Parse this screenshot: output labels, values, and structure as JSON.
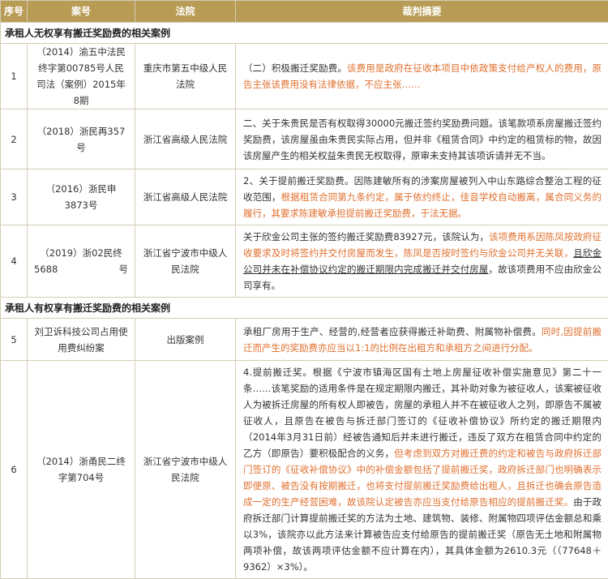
{
  "header": {
    "no": "序号",
    "case_no": "案号",
    "court": "法院",
    "summary": "裁判摘要"
  },
  "sections": [
    {
      "title": "承租人无权享有搬迁奖励费的相关案例",
      "rows": [
        {
          "no": "1",
          "case_no": "（2014）渝五中法民终字第00785号人民司法（案例）2015年8期",
          "court": "重庆市第五中级人民法院",
          "summary": [
            {
              "text": "（二）积极搬迁奖励费。",
              "style": ""
            },
            {
              "text": "该费用是政府在征收本项目中依政策支付给产权人的费用，原告主张该费用没有法律依据，不应主张……",
              "style": "orange"
            }
          ]
        },
        {
          "no": "2",
          "case_no": "（2018）浙民再357号",
          "court": "浙江省高级人民法院",
          "summary": [
            {
              "text": "二、关于朱贵民是否有权取得30000元搬迁签约奖励费问题。该笔款项系房屋搬迁签约奖励费，该房屋虽由朱贵民实际占用，但并非《租赁合同》中约定的租赁标的物，故因该房屋产生的相关权益朱贵民无权取得，原审未支持其该项诉请并无不当。",
              "style": ""
            }
          ]
        },
        {
          "no": "3",
          "case_no": "（2016）浙民申3873号",
          "court": "浙江省高级人民法院",
          "summary": [
            {
              "text": "2、关于提前搬迁奖励费。因陈建敏所有的涉案房屋被列入中山东路综合整治工程的征收范围，",
              "style": ""
            },
            {
              "text": "根据租赁合同第九条约定，属于依约终止，佳音学校自动搬离，属合同义务的履行，其要求陈建敏承担提前搬迁奖励费，于法无据。",
              "style": "orange"
            }
          ]
        },
        {
          "no": "4",
          "case_no": "（2019）浙02民终5688号",
          "court": "浙江省宁波市中级人民法院",
          "summary": [
            {
              "text": "关于欣金公司主张的签约搬迁奖励费83927元，该院认为，",
              "style": ""
            },
            {
              "text": "该项费用系因陈凤按政府征收要求及时将签约并交付房屋而发生，陈凤是否按时签约与欣金公司并无关联，",
              "style": "orange"
            },
            {
              "text": "且欣金公司并未在补偿协议约定的搬迁期限内完成搬迁并交付房屋",
              "style": "underline"
            },
            {
              "text": "，故该项费用不应由欣金公司享有。",
              "style": ""
            }
          ]
        }
      ]
    },
    {
      "title": "承租人有权享有搬迁奖励费的相关案例",
      "rows": [
        {
          "no": "5",
          "case_no": "刘卫诉科技公司占用使用费纠纷案",
          "court": "出版案例",
          "summary": [
            {
              "text": "承租厂房用于生产、经营的,经营者应获得搬迁补助费、附属物补偿费。",
              "style": ""
            },
            {
              "text": "同时,因提前搬迁而产生的奖励费亦应当以1:1的比例在出租方和承租方之间进行分配。",
              "style": "orange"
            }
          ]
        },
        {
          "no": "6",
          "case_no": "（2014）浙甬民二终字第704号",
          "court": "浙江省宁波市中级人民法院",
          "summary": [
            {
              "text": "4.提前搬迁奖。根据《宁波市镇海区国有土地上房屋征收补偿实施意见》第二十一条……该笔奖励的适用条件是在规定期限内搬迁，其补助对象为被征收人，该案被征收人为被拆迁房屋的所有权人即被告，房屋的承租人并不在被征收人之列，即原告不属被征收人，且原告在被告与拆迁部门签订的《征收补偿协议》所约定的搬迁期限内（2014年3月31日前）经被告通知后并未进行搬迁，违反了双方在租赁合同中约定的乙方（即原告）要积极配合的义务，",
              "style": ""
            },
            {
              "text": "但考虑到双方对搬迁费的约定和被告与政府拆迁部门签订的《征收补偿协议》中的补偿金额包括了提前搬迁奖，政府拆迁部门也明确表示即便原、被告没有按期搬迁，也将支付提前搬迁奖励费给出租人，且拆迁也确会原告造成一定的生产经营困难，故该院认定被告亦应当支付给原告相应的提前搬迁奖。",
              "style": "orange"
            },
            {
              "text": "由于政府拆迁部门计算提前搬迁奖的方法为土地、建筑物、装修、附属物四项评估金额总和乘以3%，该院亦以此方法来计算被告应支付给原告的提前搬迁奖（原告无土地和附属物两项补偿，故该两项评估金额不应计算在内），其具体金额为2610.3元（（77648＋9362）×3%）。",
              "style": ""
            }
          ]
        }
      ]
    }
  ]
}
